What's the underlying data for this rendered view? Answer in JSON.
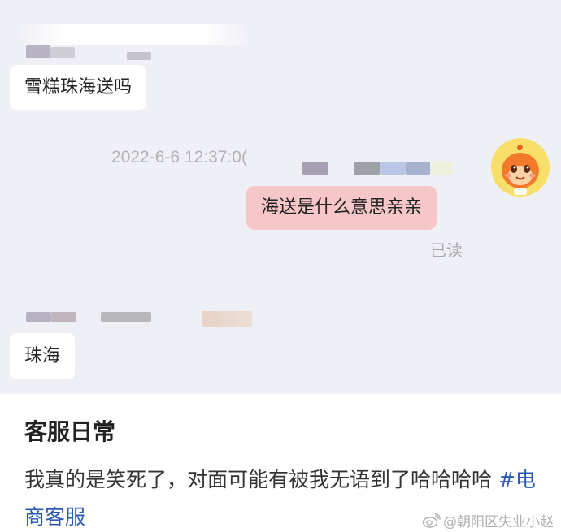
{
  "conversation": {
    "messages": [
      {
        "direction": "incoming",
        "text": "雪糕珠海送吗"
      },
      {
        "direction": "outgoing",
        "text": "海送是什么意思亲亲",
        "read_status": "已读"
      },
      {
        "direction": "incoming",
        "text": "珠海"
      }
    ],
    "timestamp": "2022-6-6 12:37:0("
  },
  "avatar": {
    "icon": "orange-mascot-avatar-icon"
  },
  "caption": {
    "title": "客服日常",
    "body_text": "我真的是笑死了，对面可能有被我无语到了哈哈哈哈",
    "hashtag": "#电商客服"
  },
  "watermark": {
    "icon": "weibo-logo-icon",
    "text": "@朝阳区失业小赵"
  },
  "colors": {
    "chat_background": "#eff0f6",
    "outgoing_bubble": "#f7c6c8",
    "incoming_bubble": "#ffffff",
    "hashtag": "#2a59b3"
  }
}
